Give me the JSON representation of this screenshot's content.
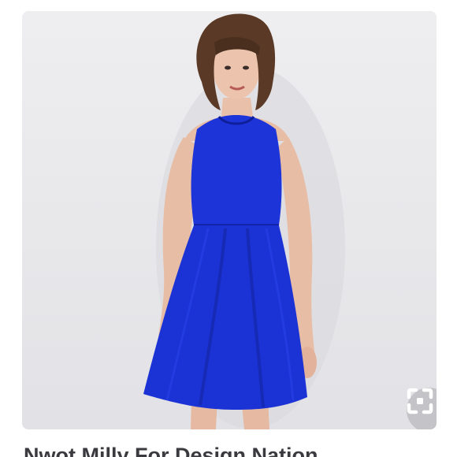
{
  "listing": {
    "title": "Nwot Milly For Design Nation",
    "image_subject": "model-wearing-blue-dress",
    "zoom_icon": "expand-viewfinder-icon"
  },
  "colors": {
    "dress": "#1a2fd6",
    "photo_background": "#eaeaed",
    "title_text": "#3a3a3f",
    "zoom_button": "#bebec2"
  }
}
